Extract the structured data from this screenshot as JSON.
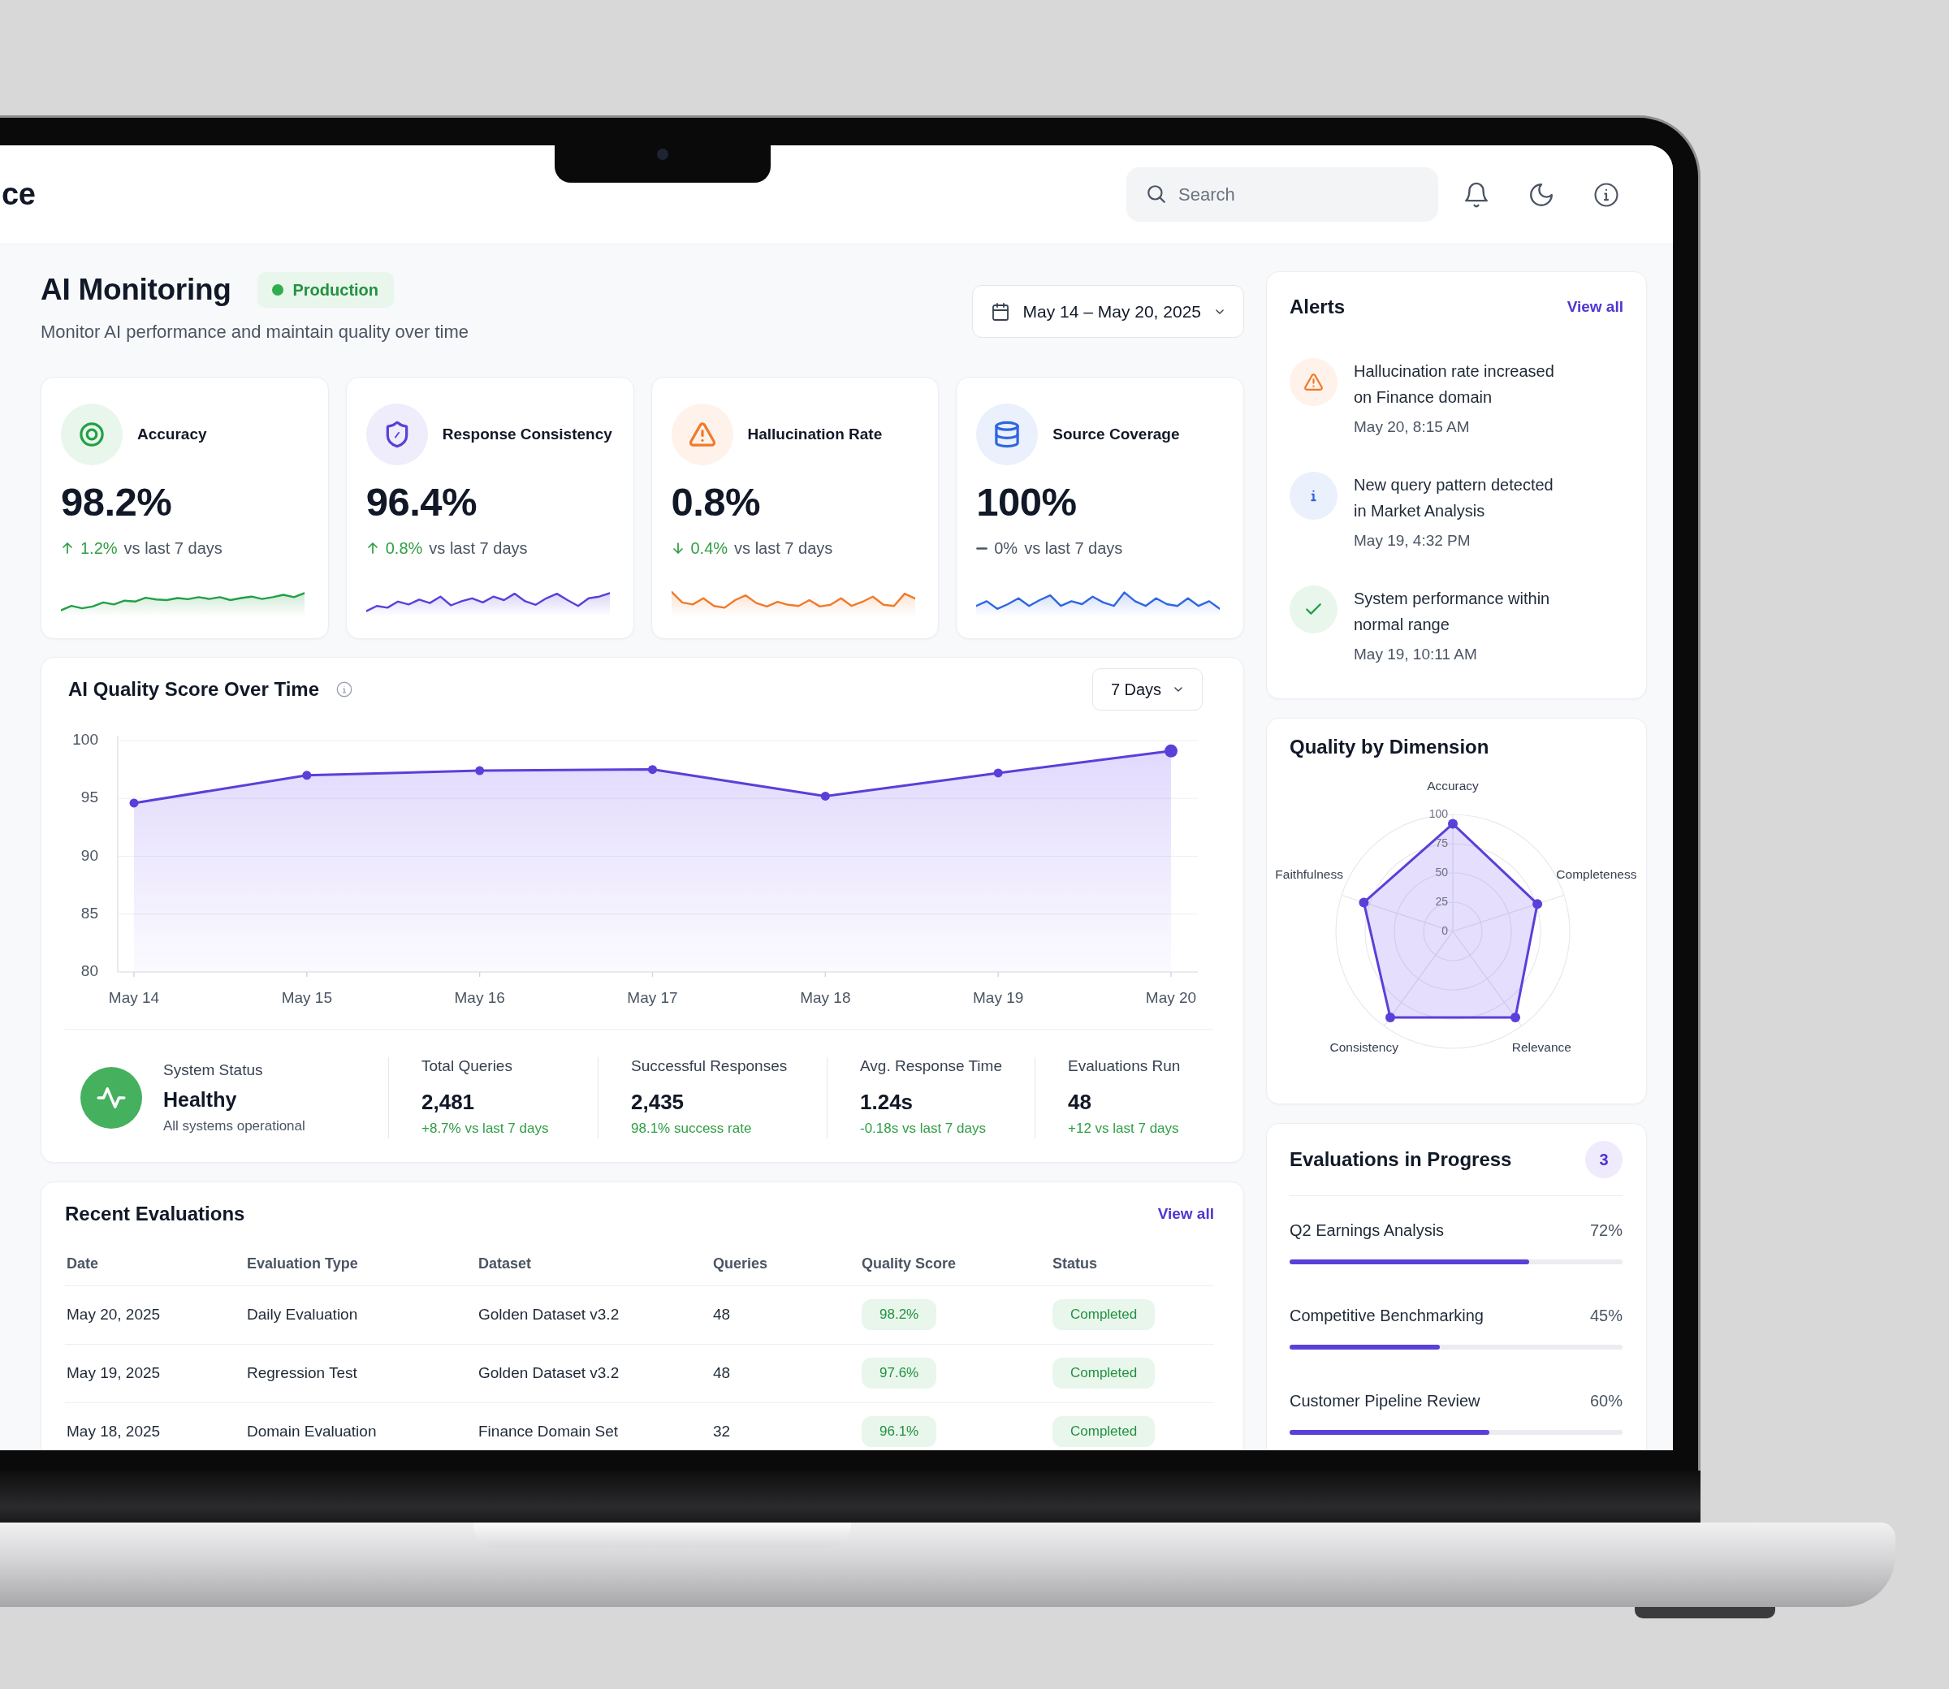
{
  "header": {
    "title": "ce",
    "search": {
      "placeholder": "Search"
    }
  },
  "page": {
    "title": "AI Monitoring",
    "environment": "Production",
    "subtitle": "Monitor AI performance and maintain quality over time",
    "date_range": "May 14 – May 20, 2025"
  },
  "kpis": [
    {
      "kind": "accuracy",
      "label": "Accuracy",
      "value": "98.2%",
      "change": {
        "kind": "up",
        "value": "1.2%",
        "comparison": "vs last 7 days"
      }
    },
    {
      "kind": "consistency",
      "label": "Response Consistency",
      "value": "96.4%",
      "change": {
        "kind": "up",
        "value": "0.8%",
        "comparison": "vs last 7 days"
      }
    },
    {
      "kind": "hallucination",
      "label": "Hallucination Rate",
      "value": "0.8%",
      "change": {
        "kind": "down",
        "value": "0.4%",
        "comparison": "vs last 7 days"
      }
    },
    {
      "kind": "coverage",
      "label": "Source Coverage",
      "value": "100%",
      "change": {
        "kind": "flat",
        "value": "0%",
        "comparison": "vs last 7 days"
      }
    }
  ],
  "quality_chart": {
    "title": "AI Quality Score Over Time",
    "range": "7 Days",
    "chart_data": {
      "type": "area",
      "categories": [
        "May 14",
        "May 15",
        "May 16",
        "May 17",
        "May 18",
        "May 19",
        "May 20"
      ],
      "values": [
        94.6,
        97.0,
        97.4,
        97.5,
        95.2,
        97.2,
        99.1
      ],
      "ylim": [
        80,
        100
      ],
      "yticks": [
        80,
        85,
        90,
        95,
        100
      ],
      "grid": true
    }
  },
  "system_status": {
    "label": "System Status",
    "value": "Healthy",
    "note": "All systems operational"
  },
  "stats": [
    {
      "label": "Total Queries",
      "value": "2,481",
      "change": "+8.7% vs last 7 days"
    },
    {
      "label": "Successful Responses",
      "value": "2,435",
      "change": "98.1% success rate"
    },
    {
      "label": "Avg. Response Time",
      "value": "1.24s",
      "change": "-0.18s vs last 7 days"
    },
    {
      "label": "Evaluations Run",
      "value": "48",
      "change": "+12 vs last 7 days"
    }
  ],
  "recent_evaluations": {
    "title": "Recent Evaluations",
    "link": "View all",
    "columns": [
      {
        "label": "Date",
        "kind": "text"
      },
      {
        "label": "Evaluation Type",
        "kind": "text"
      },
      {
        "label": "Dataset",
        "kind": "text"
      },
      {
        "label": "Queries",
        "kind": "text"
      },
      {
        "label": "Quality Score",
        "kind": "score"
      },
      {
        "label": "Status",
        "kind": "status"
      }
    ],
    "rows": [
      [
        "May 20, 2025",
        "Daily Evaluation",
        "Golden Dataset v3.2",
        "48",
        "98.2%",
        "Completed"
      ],
      [
        "May 19, 2025",
        "Regression Test",
        "Golden Dataset v3.2",
        "48",
        "97.6%",
        "Completed"
      ],
      [
        "May 18, 2025",
        "Domain Evaluation",
        "Finance Domain Set",
        "32",
        "96.1%",
        "Completed"
      ]
    ]
  },
  "alerts": {
    "title": "Alerts",
    "link": "View all",
    "items": [
      {
        "kind": "warning",
        "text": "Hallucination rate increased on Finance domain",
        "time": "May 20, 8:15 AM"
      },
      {
        "kind": "info",
        "text": "New query pattern detected in Market Analysis",
        "time": "May 19, 4:32 PM"
      },
      {
        "kind": "success",
        "text": "System performance within normal range",
        "time": "May 19, 10:11 AM"
      }
    ]
  },
  "quality_by_dimension": {
    "title": "Quality by Dimension",
    "axes": [
      "Accuracy",
      "Completeness",
      "Relevance",
      "Consistency",
      "Faithfulness"
    ],
    "scale": [
      "100",
      "75",
      "50",
      "25",
      "0"
    ]
  },
  "evaluations_in_progress": {
    "title": "Evaluations in Progress",
    "count": "3",
    "items": [
      {
        "name": "Q2 Earnings Analysis",
        "percent": "72%",
        "level": 0.72
      },
      {
        "name": "Competitive Benchmarking",
        "percent": "45%",
        "level": 0.45
      },
      {
        "name": "Customer Pipeline Review",
        "percent": "60%",
        "level": 0.6
      }
    ]
  }
}
